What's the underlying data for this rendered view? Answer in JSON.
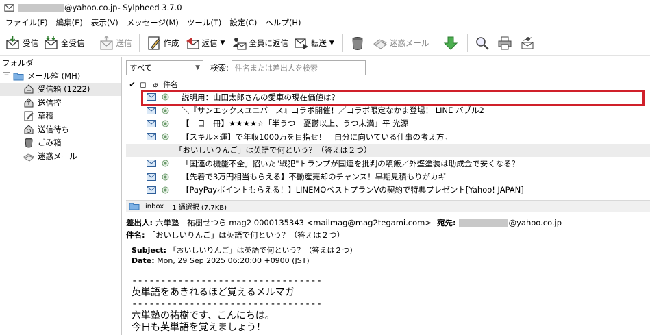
{
  "titlebar": {
    "account_suffix": "@yahoo.co.jp",
    "app_title": " - Sylpheed 3.7.0"
  },
  "menu": [
    "ファイル(F)",
    "編集(E)",
    "表示(V)",
    "メッセージ(M)",
    "ツール(T)",
    "設定(C)",
    "ヘルプ(H)"
  ],
  "toolbar": {
    "receive": "受信",
    "receive_all": "全受信",
    "send": "送信",
    "compose": "作成",
    "reply": "返信",
    "reply_all": "全員に返信",
    "forward": "転送",
    "spam": "迷惑メール"
  },
  "folders": {
    "header": "フォルダ",
    "root": "メール箱 (MH)",
    "items": [
      {
        "label": "受信箱 (1222)",
        "icon": "inbox-icon"
      },
      {
        "label": "送信控",
        "icon": "sent-icon"
      },
      {
        "label": "草稿",
        "icon": "draft-icon"
      },
      {
        "label": "送信待ち",
        "icon": "queue-icon"
      },
      {
        "label": "ごみ箱",
        "icon": "trash-icon"
      },
      {
        "label": "迷惑メール",
        "icon": "junk-icon"
      }
    ]
  },
  "filter": {
    "selected": "すべて",
    "search_label": "検索:",
    "search_placeholder": "件名または差出人を検索"
  },
  "list": {
    "header_check": "✔",
    "header_subject": "件名",
    "rows": [
      {
        "subject": "説明用：山田太郎さんの愛車の現在価値は？",
        "marked": true
      },
      {
        "subject": "＼『サンエックスユニバース』コラボ開催！／コラボ限定なかま登場！ LINE バブル2",
        "marked": true
      },
      {
        "subject": "【一日一冊】★★★★☆「半うつ　憂鬱以上、うつ未満」平 光源",
        "marked": true
      },
      {
        "subject": "【スキル×運】で年収1000万を目指せ！　自分に向いている仕事の考え方。",
        "marked": true
      },
      {
        "subject": "「おいしいりんご」は英語で何という？（答えは２つ）",
        "marked": false
      },
      {
        "subject": "「国連の機能不全」招いた\"戦犯\"トランプが国連を批判の噴飯／外壁塗装は助成金で安くなる？",
        "marked": true
      },
      {
        "subject": "【先着で3万円相当もらえる】不動産売却のチャンス！早期見積もりがカギ",
        "marked": true
      },
      {
        "subject": "【PayPayポイントもらえる！】LINEMOベストプランVの契約で特典プレゼント[Yahoo! JAPAN]",
        "marked": true
      }
    ]
  },
  "status": {
    "folder": "inbox",
    "selection": "1 通選択 (7.7KB)"
  },
  "message_header": {
    "from_label": "差出人:",
    "from_value": "六単塾　祐樹せつら mag2 0000135343 <mailmag@mag2tegami.com>",
    "to_label": "宛先:",
    "to_suffix": "@yahoo.co.jp",
    "subject_label": "件名:",
    "subject_value": "「おいしいりんご」は英語で何という？（答えは２つ）"
  },
  "message_body": {
    "subject_label": "Subject:",
    "subject_value": "「おいしいりんご」は英語で何という？（答えは２つ）",
    "date_label": "Date:",
    "date_value": "Mon, 29 Sep 2025 06:20:00 +0900 (JST)",
    "text": "---------------------------------\n英単語をあきれるほど覚えるメルマガ\n---------------------------------\n六単塾の祐樹です、こんにちは。\n今日も英単語を覚えましょう！"
  },
  "colors": {
    "highlight_border": "#d0202a",
    "selected_row": "#ececec",
    "folder_icon": "#5b9bd5"
  }
}
